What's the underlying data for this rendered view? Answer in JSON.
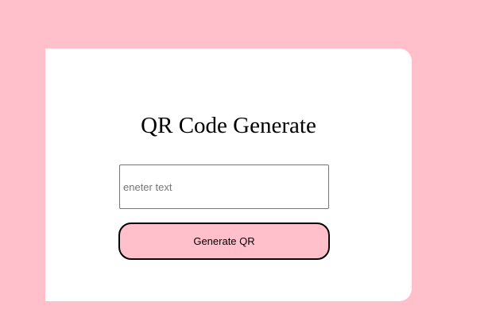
{
  "colors": {
    "page_background": "#ffc0cb",
    "card_background": "#ffffff",
    "button_background": "#ffc0cb",
    "button_border": "#000000"
  },
  "app": {
    "title": "QR Code Generate"
  },
  "form": {
    "text_input": {
      "value": "",
      "placeholder": "eneter text"
    },
    "generate_button_label": "Generate QR"
  }
}
